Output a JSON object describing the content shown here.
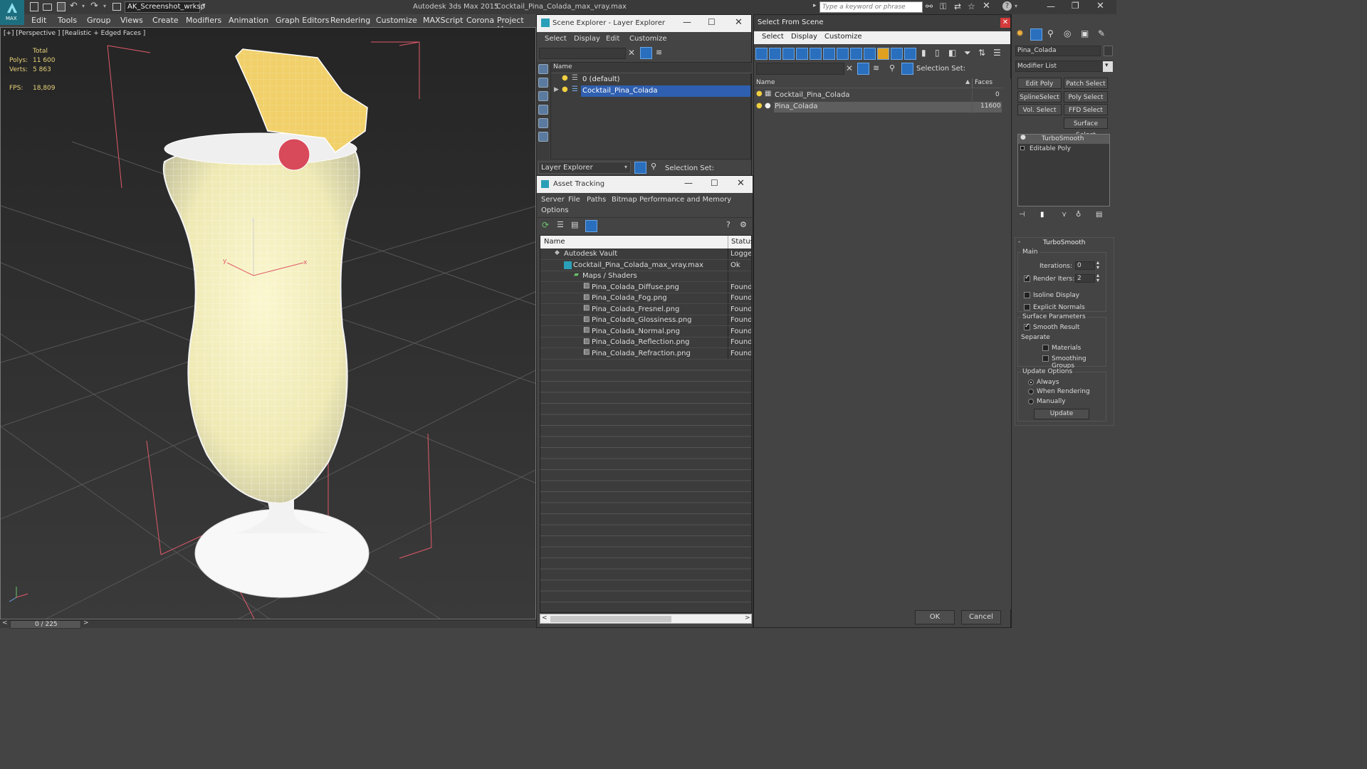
{
  "app": {
    "title": "Autodesk 3ds Max  2015",
    "file": "Cocktail_Pina_Colada_max_vray.max",
    "workspace": "AK_Screenshot_wrksp",
    "search_placeholder": "Type a keyword or phrase",
    "logo": "MAX"
  },
  "menubar": [
    "Edit",
    "Tools",
    "Group",
    "Views",
    "Create",
    "Modifiers",
    "Animation",
    "Graph Editors",
    "Rendering",
    "Customize",
    "MAXScript",
    "Corona",
    "Project Man"
  ],
  "viewport": {
    "label": "[+] [Perspective ] [Realistic + Edged Faces ]",
    "stats_header": "Total",
    "polys_label": "Polys:",
    "polys_value": "11 600",
    "verts_label": "Verts:",
    "verts_value": "5 863",
    "fps_label": "FPS:",
    "fps_value": "18,809",
    "timeline": "0 / 225",
    "axis_x": "x",
    "axis_y": "y",
    "axis_z": "z"
  },
  "scene_explorer": {
    "title": "Scene Explorer - Layer Explorer",
    "menu": [
      "Select",
      "Display",
      "Edit",
      "Customize"
    ],
    "col_name": "Name",
    "rows": [
      "0 (default)",
      "Cocktail_Pina_Colada"
    ],
    "footer_dropdown": "Layer Explorer",
    "selection_set": "Selection Set:"
  },
  "asset_tracking": {
    "title": "Asset Tracking",
    "menu": [
      "Server",
      "File",
      "Paths",
      "Bitmap Performance and Memory"
    ],
    "menu2": "Options",
    "col_name": "Name",
    "col_status": "Status",
    "rows": [
      {
        "name": "Autodesk Vault",
        "status": "Logged"
      },
      {
        "name": "Cocktail_Pina_Colada_max_vray.max",
        "status": "Ok"
      },
      {
        "name": "Maps / Shaders",
        "status": ""
      },
      {
        "name": "Pina_Colada_Diffuse.png",
        "status": "Found"
      },
      {
        "name": "Pina_Colada_Fog.png",
        "status": "Found"
      },
      {
        "name": "Pina_Colada_Fresnel.png",
        "status": "Found"
      },
      {
        "name": "Pina_Colada_Glossiness.png",
        "status": "Found"
      },
      {
        "name": "Pina_Colada_Normal.png",
        "status": "Found"
      },
      {
        "name": "Pina_Colada_Reflection.png",
        "status": "Found"
      },
      {
        "name": "Pina_Colada_Refraction.png",
        "status": "Found"
      }
    ]
  },
  "select_from_scene": {
    "title": "Select From Scene",
    "menu": [
      "Select",
      "Display",
      "Customize"
    ],
    "selection_set": "Selection Set:",
    "col_name": "Name",
    "col_faces": "Faces",
    "rows": [
      {
        "name": "Cocktail_Pina_Colada",
        "faces": "0"
      },
      {
        "name": "Pina_Colada",
        "faces": "11600"
      }
    ],
    "ok": "OK",
    "cancel": "Cancel"
  },
  "command_panel": {
    "object_name": "Pina_Colada",
    "modifier_list": "Modifier List",
    "buttons": [
      "Edit Poly",
      "Patch Select",
      "SplineSelect",
      "Poly Select",
      "Vol. Select",
      "FFD Select",
      "Surface Select"
    ],
    "stack": [
      "TurboSmooth",
      "Editable Poly"
    ],
    "rollout_title": "TurboSmooth",
    "main": "Main",
    "iterations_label": "Iterations:",
    "iterations_value": "0",
    "render_iters_label": "Render Iters:",
    "render_iters_value": "2",
    "isoline": "Isoline Display",
    "explicit": "Explicit Normals",
    "surface_params": "Surface Parameters",
    "smooth_result": "Smooth Result",
    "separate": "Separate",
    "materials": "Materials",
    "smoothing_groups": "Smoothing Groups",
    "update_options": "Update Options",
    "always": "Always",
    "when_rendering": "When Rendering",
    "manually": "Manually",
    "update": "Update"
  },
  "colors": {
    "accent": "#2a6fbd",
    "selection": "#2f5fb0",
    "panel": "#444444",
    "viewport_bg": "#2e2e2e",
    "grid": "#5a5a5a",
    "stats": "#e8d27a"
  }
}
